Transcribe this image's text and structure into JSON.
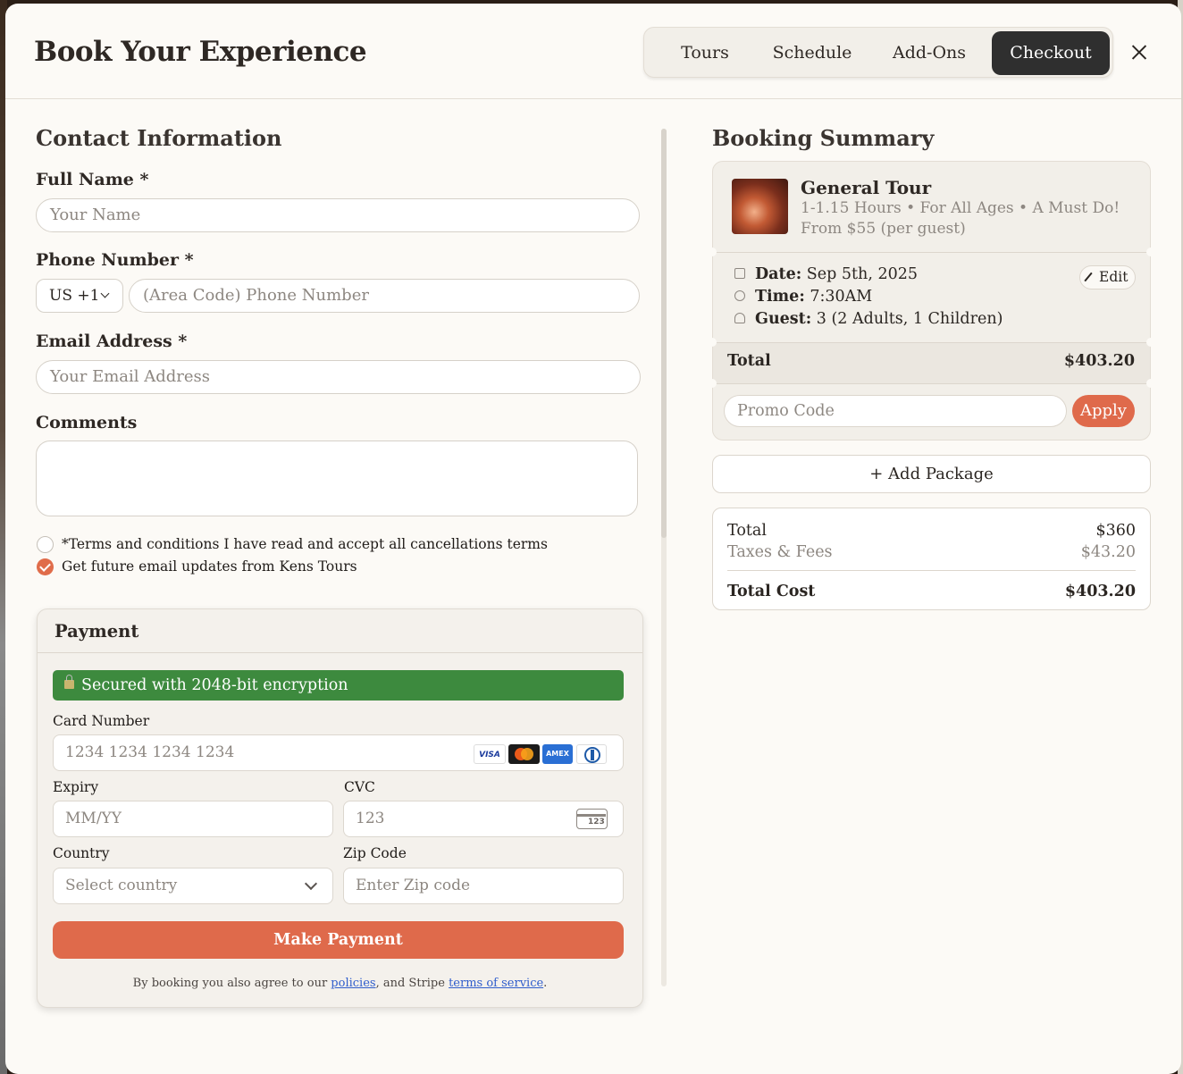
{
  "header": {
    "title": "Book Your Experience",
    "tabs": [
      {
        "label": "Tours"
      },
      {
        "label": "Schedule"
      },
      {
        "label": "Add-Ons"
      },
      {
        "label": "Checkout",
        "active": true
      }
    ]
  },
  "contact": {
    "title": "Contact Information",
    "full_name_label": "Full Name *",
    "full_name_placeholder": "Your Name",
    "phone_label": "Phone Number *",
    "country_code": "US +1",
    "phone_placeholder": "(Area Code) Phone Number",
    "email_label": "Email Address *",
    "email_placeholder": "Your Email Address",
    "comments_label": "Comments",
    "terms_text": "*Terms and conditions I have read and accept all cancellations terms",
    "terms_checked": false,
    "updates_text": "Get future email updates from Kens Tours",
    "updates_checked": true
  },
  "payment": {
    "title": "Payment",
    "secure_text": "Secured with 2048-bit encryption",
    "card_label": "Card Number",
    "card_placeholder": "1234 1234 1234 1234",
    "card_brands": [
      "VISA",
      "mastercard",
      "AMEX",
      "diners"
    ],
    "expiry_label": "Expiry",
    "expiry_placeholder": "MM/YY",
    "cvc_label": "CVC",
    "cvc_placeholder": "123",
    "cvc_icon_text": "123",
    "country_label": "Country",
    "country_placeholder": "Select country",
    "zip_label": "Zip Code",
    "zip_placeholder": "Enter Zip code",
    "button": "Make Payment",
    "legal_pre": "By booking you also agree to our ",
    "legal_link1": "policies",
    "legal_mid": ", and Stripe ",
    "legal_link2": "terms of service",
    "legal_post": "."
  },
  "summary": {
    "title": "Booking Summary",
    "tour_name": "General Tour",
    "tour_details": "1-1.15 Hours • For All Ages • A Must Do!",
    "tour_price": "From $55 (per guest)",
    "date_label": "Date:",
    "date_value": "Sep 5th, 2025",
    "time_label": "Time:",
    "time_value": "7:30AM",
    "guest_label": "Guest:",
    "guest_value": "3 (2 Adults, 1 Children)",
    "edit_label": "Edit",
    "total_label": "Total",
    "total_value": "$403.20",
    "promo_placeholder": "Promo Code",
    "apply_label": "Apply",
    "add_package": "+ Add Package"
  },
  "costs": {
    "total_label": "Total",
    "total_value": "$360",
    "taxes_label": "Taxes & Fees",
    "taxes_value": "$43.20",
    "total_cost_label": "Total Cost",
    "total_cost_value": "$403.20"
  },
  "colors": {
    "accent": "#df6a4b",
    "secure_green": "#3d8a3e",
    "active_tab": "#2f2f2f",
    "background": "#fcfaf6"
  }
}
